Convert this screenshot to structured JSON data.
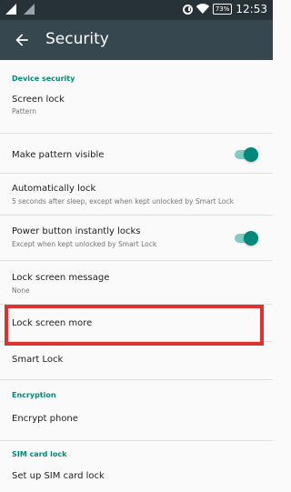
{
  "status_bar": {
    "time": "12:53",
    "battery": "73%"
  },
  "toolbar": {
    "title": "Security"
  },
  "sections": {
    "device_security": "Device security",
    "encryption": "Encryption",
    "sim_card_lock": "SIM card lock"
  },
  "items": {
    "screen_lock": {
      "title": "Screen lock",
      "subtitle": "Pattern"
    },
    "make_pattern_visible": {
      "title": "Make pattern visible",
      "toggle": "on"
    },
    "automatically_lock": {
      "title": "Automatically lock",
      "subtitle": "5 seconds after sleep, except when kept unlocked by Smart Lock"
    },
    "power_button_lock": {
      "title": "Power button instantly locks",
      "subtitle": "Except when kept unlocked by Smart Lock",
      "toggle": "on"
    },
    "lock_screen_message": {
      "title": "Lock screen message",
      "subtitle": "None"
    },
    "lock_screen_more": {
      "title": "Lock screen more"
    },
    "smart_lock": {
      "title": "Smart Lock"
    },
    "encrypt_phone": {
      "title": "Encrypt phone"
    },
    "set_up_sim_lock": {
      "title": "Set up SIM card lock"
    }
  },
  "colors": {
    "accent": "#00897b",
    "toolbar": "#37474f",
    "statusbar": "#263238",
    "highlight": "#e03030"
  }
}
